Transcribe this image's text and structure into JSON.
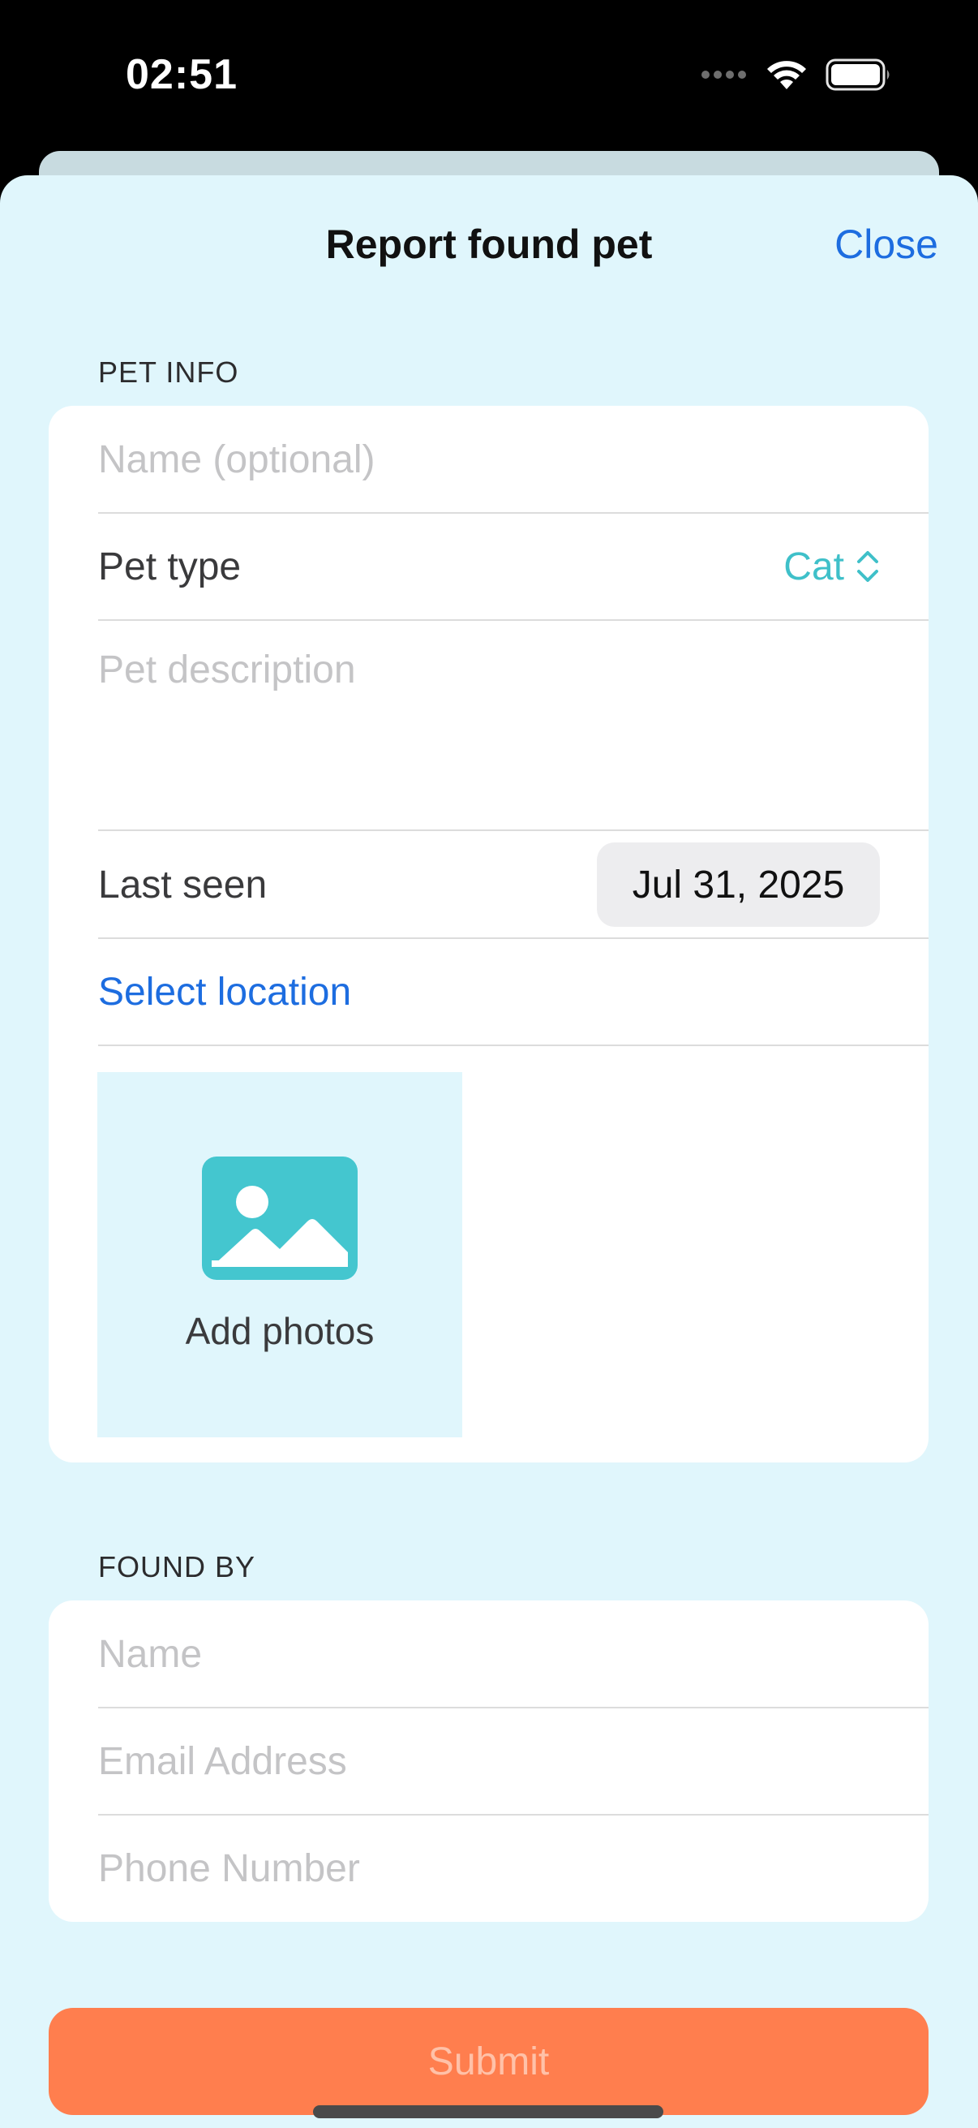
{
  "status_bar": {
    "time": "02:51",
    "icons": [
      "signal-dots-icon",
      "wifi-icon",
      "battery-icon"
    ]
  },
  "nav": {
    "title": "Report found pet",
    "close_label": "Close"
  },
  "pet_info": {
    "header": "PET INFO",
    "name_placeholder": "Name (optional)",
    "pet_type_label": "Pet type",
    "pet_type_value": "Cat",
    "description_placeholder": "Pet description",
    "last_seen_label": "Last seen",
    "last_seen_value": "Jul 31, 2025",
    "select_location_label": "Select location",
    "add_photos_label": "Add photos"
  },
  "found_by": {
    "header": "FOUND BY",
    "name_placeholder": "Name",
    "email_placeholder": "Email Address",
    "phone_placeholder": "Phone Number"
  },
  "submit_label": "Submit",
  "colors": {
    "background": "#e0f6fc",
    "accent_link": "#1d6de0",
    "accent_teal": "#3fc0c9",
    "submit": "#ff7e4e"
  }
}
